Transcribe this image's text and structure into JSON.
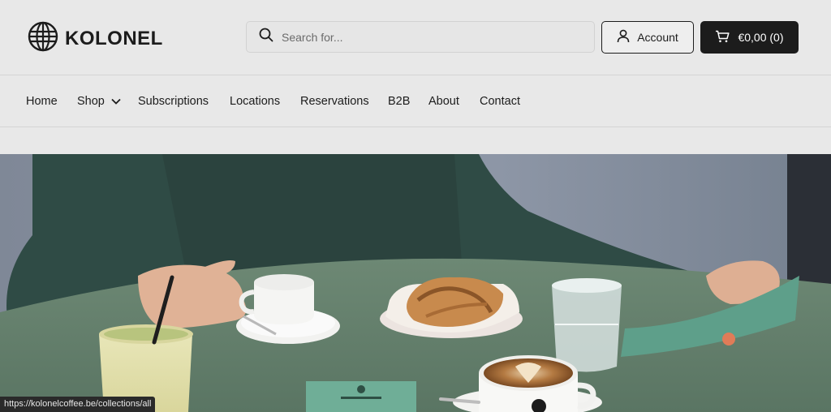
{
  "brand": {
    "name": "KOLONEL",
    "logo_icon": "globe-icon"
  },
  "search": {
    "placeholder": "Search for...",
    "icon": "search-icon"
  },
  "account": {
    "label": "Account",
    "icon": "user-icon"
  },
  "cart": {
    "label": "€0,00 (0)",
    "icon": "cart-icon"
  },
  "nav": {
    "items": [
      {
        "label": "Home"
      },
      {
        "label": "Shop",
        "has_dropdown": true
      },
      {
        "label": "Subscriptions"
      },
      {
        "label": "Locations"
      },
      {
        "label": "Reservations"
      },
      {
        "label": "B2B"
      },
      {
        "label": "About"
      },
      {
        "label": "Contact"
      }
    ]
  },
  "status_bar": {
    "url": "https://kolonelcoffee.be/collections/all"
  },
  "colors": {
    "background": "#e8e8e8",
    "text": "#1c1c1c",
    "cart_button": "#1c1c1c",
    "table": "#5f7a67"
  }
}
